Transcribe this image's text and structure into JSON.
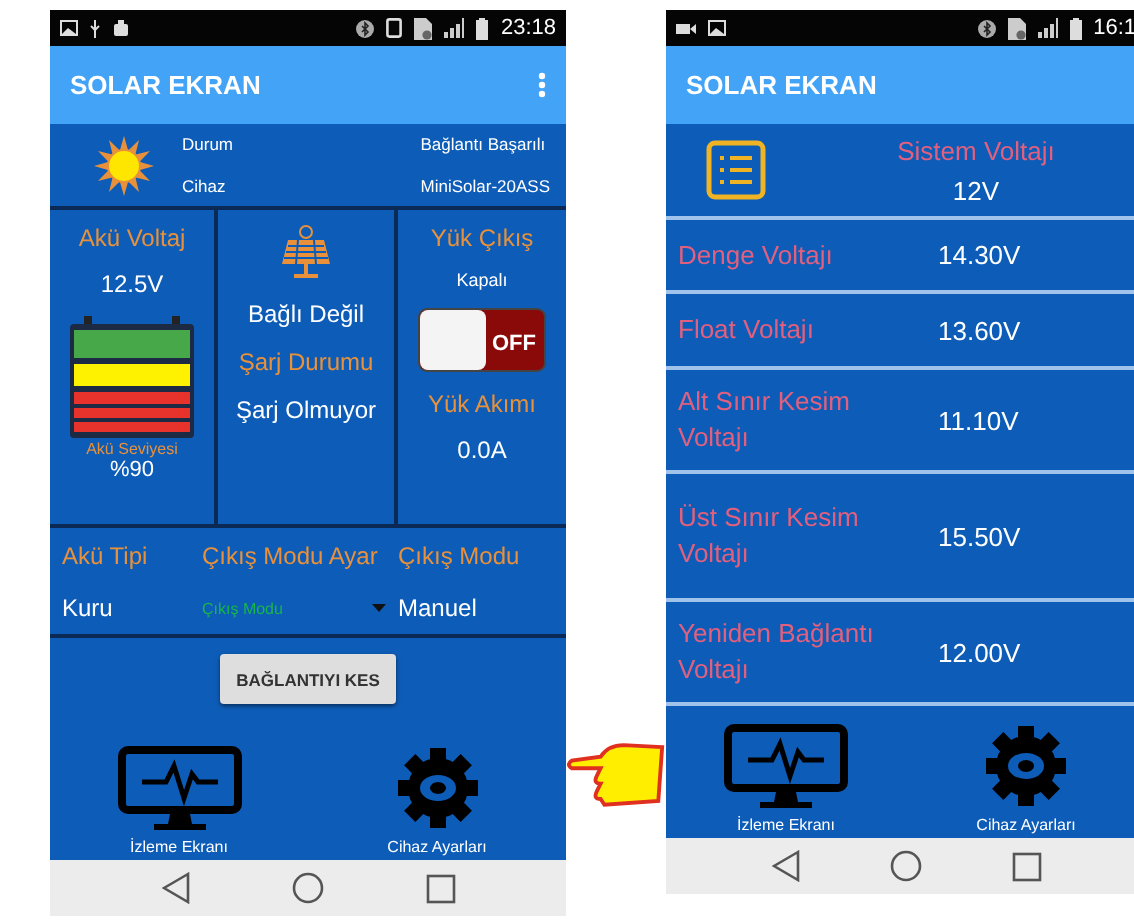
{
  "left_screen": {
    "status_bar": {
      "time": "23:18"
    },
    "app_bar": {
      "title": "SOLAR EKRAN"
    },
    "device_info": [
      {
        "label": "Durum",
        "value": "Bağlantı Başarılı"
      },
      {
        "label": "Cihaz",
        "value": "MiniSolar-20ASS"
      }
    ],
    "battery": {
      "title": "Akü Voltaj",
      "voltage": "12.5V",
      "level_label": "Akü Seviyesi",
      "percent": "%90"
    },
    "panel": {
      "status": "Bağlı Değil",
      "charge_title": "Şarj Durumu",
      "charge_status": "Şarj Olmuyor"
    },
    "load": {
      "title": "Yük Çıkış",
      "state": "Kapalı",
      "switch": {
        "label": "OFF",
        "on": false
      },
      "current_title": "Yük Akımı",
      "current": "0.0A"
    },
    "settings_headers": [
      "Akü Tipi",
      "Çıkış Modu Ayar",
      "Çıkış Modu"
    ],
    "battery_type": "Kuru",
    "mode_select": {
      "placeholder": "Çıkış Modu"
    },
    "output_mode": "Manuel",
    "disconnect_button": "BAĞLANTIYI KES",
    "bottom_nav": [
      {
        "kind": "monitor",
        "label": "İzleme Ekranı"
      },
      {
        "kind": "gear",
        "label": "Cihaz Ayarları"
      }
    ]
  },
  "right_screen": {
    "status_bar": {
      "time": "16:1"
    },
    "app_bar": {
      "title": "SOLAR EKRAN"
    },
    "system": {
      "label": "Sistem Voltajı",
      "value": "12V"
    },
    "rows": [
      {
        "label": "Denge Voltajı",
        "value": "14.30V"
      },
      {
        "label": "Float Voltajı",
        "value": "13.60V"
      },
      {
        "label": "Alt Sınır Kesim Voltajı",
        "value": "11.10V"
      },
      {
        "label": "Üst Sınır Kesim Voltajı",
        "value": "15.50V"
      },
      {
        "label": "Yeniden Bağlantı Voltajı",
        "value": "12.00V"
      }
    ],
    "bottom_nav": [
      {
        "kind": "monitor",
        "label": "İzleme Ekranı"
      },
      {
        "kind": "gear",
        "label": "Cihaz Ayarları"
      }
    ]
  }
}
